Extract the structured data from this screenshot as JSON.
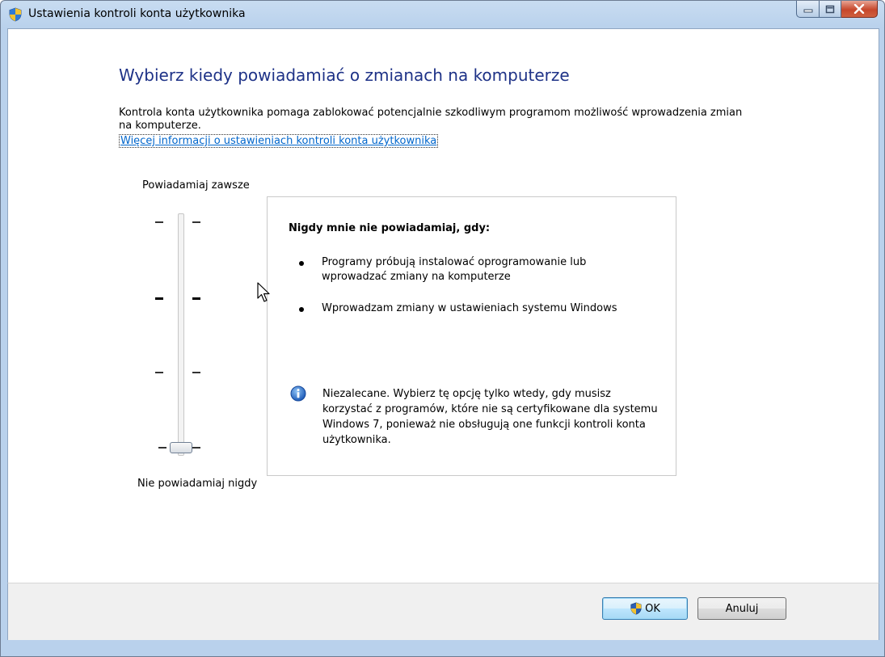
{
  "window": {
    "title": "Ustawienia kontroli konta użytkownika"
  },
  "main": {
    "heading": "Wybierz kiedy powiadamiać o zmianach na komputerze",
    "description": "Kontrola konta użytkownika pomaga zablokować potencjalnie szkodliwym programom możliwość wprowadzenia zmian na komputerze.",
    "link": "Więcej informacji o ustawieniach kontroli konta użytkownika"
  },
  "slider": {
    "top_label": "Powiadamiaj zawsze",
    "bottom_label": "Nie powiadamiaj nigdy",
    "levels": 4,
    "selected_level": 1
  },
  "info_box": {
    "title": "Nigdy mnie nie powiadamiaj, gdy:",
    "bullets": [
      "Programy próbują instalować oprogramowanie lub wprowadzać zmiany na komputerze",
      "Wprowadzam zmiany w ustawieniach systemu Windows"
    ],
    "note": "Niezalecane. Wybierz tę opcję tylko wtedy, gdy musisz korzystać z programów, które nie są certyfikowane dla systemu Windows 7, ponieważ nie obsługują one funkcji kontroli konta użytkownika."
  },
  "buttons": {
    "ok": "OK",
    "cancel": "Anuluj"
  },
  "icons": {
    "title": "uac-shield-icon",
    "note": "info-icon",
    "ok": "uac-shield-icon"
  },
  "colors": {
    "heading": "#1e3287",
    "link": "#0066cc",
    "frame": "#b9d1ec"
  }
}
